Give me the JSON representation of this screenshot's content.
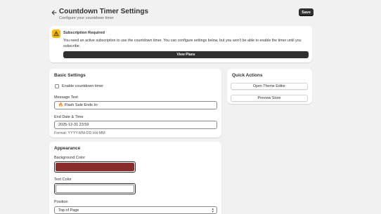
{
  "header": {
    "back_icon": "arrow-left-icon",
    "title": "Countdown Timer Settings",
    "subtitle": "Configure your countdown timer",
    "save_label": "Save"
  },
  "banner": {
    "icon": "alert-triangle-icon",
    "accent_color": "#ffb800",
    "title": "Subscription Required",
    "text": "You need an active subscription to use the countdown timer. You can configure settings below, but you won't be able to enable the timer until you subscribe.",
    "button_label": "View Plans"
  },
  "basic_settings": {
    "title": "Basic Settings",
    "enable_label": "Enable countdown timer",
    "enable_checked": false,
    "message_label": "Message Text",
    "message_value": "Flash Sale Ends In:",
    "message_icon": "fire-emoji",
    "end_label": "End Date & Time",
    "end_value": "2025-12-31 23:59",
    "end_help": "Format: YYYY-MM-DD HH:MM"
  },
  "appearance": {
    "title": "Appearance",
    "bg_label": "Background Color",
    "bg_color": "#8b2c2c",
    "text_label": "Text Color",
    "text_color": "#ffffff",
    "position_label": "Position",
    "position_value": "Top of Page"
  },
  "quick_actions": {
    "title": "Quick Actions",
    "theme_editor_label": "Open Theme Editor",
    "preview_label": "Preview Store"
  }
}
